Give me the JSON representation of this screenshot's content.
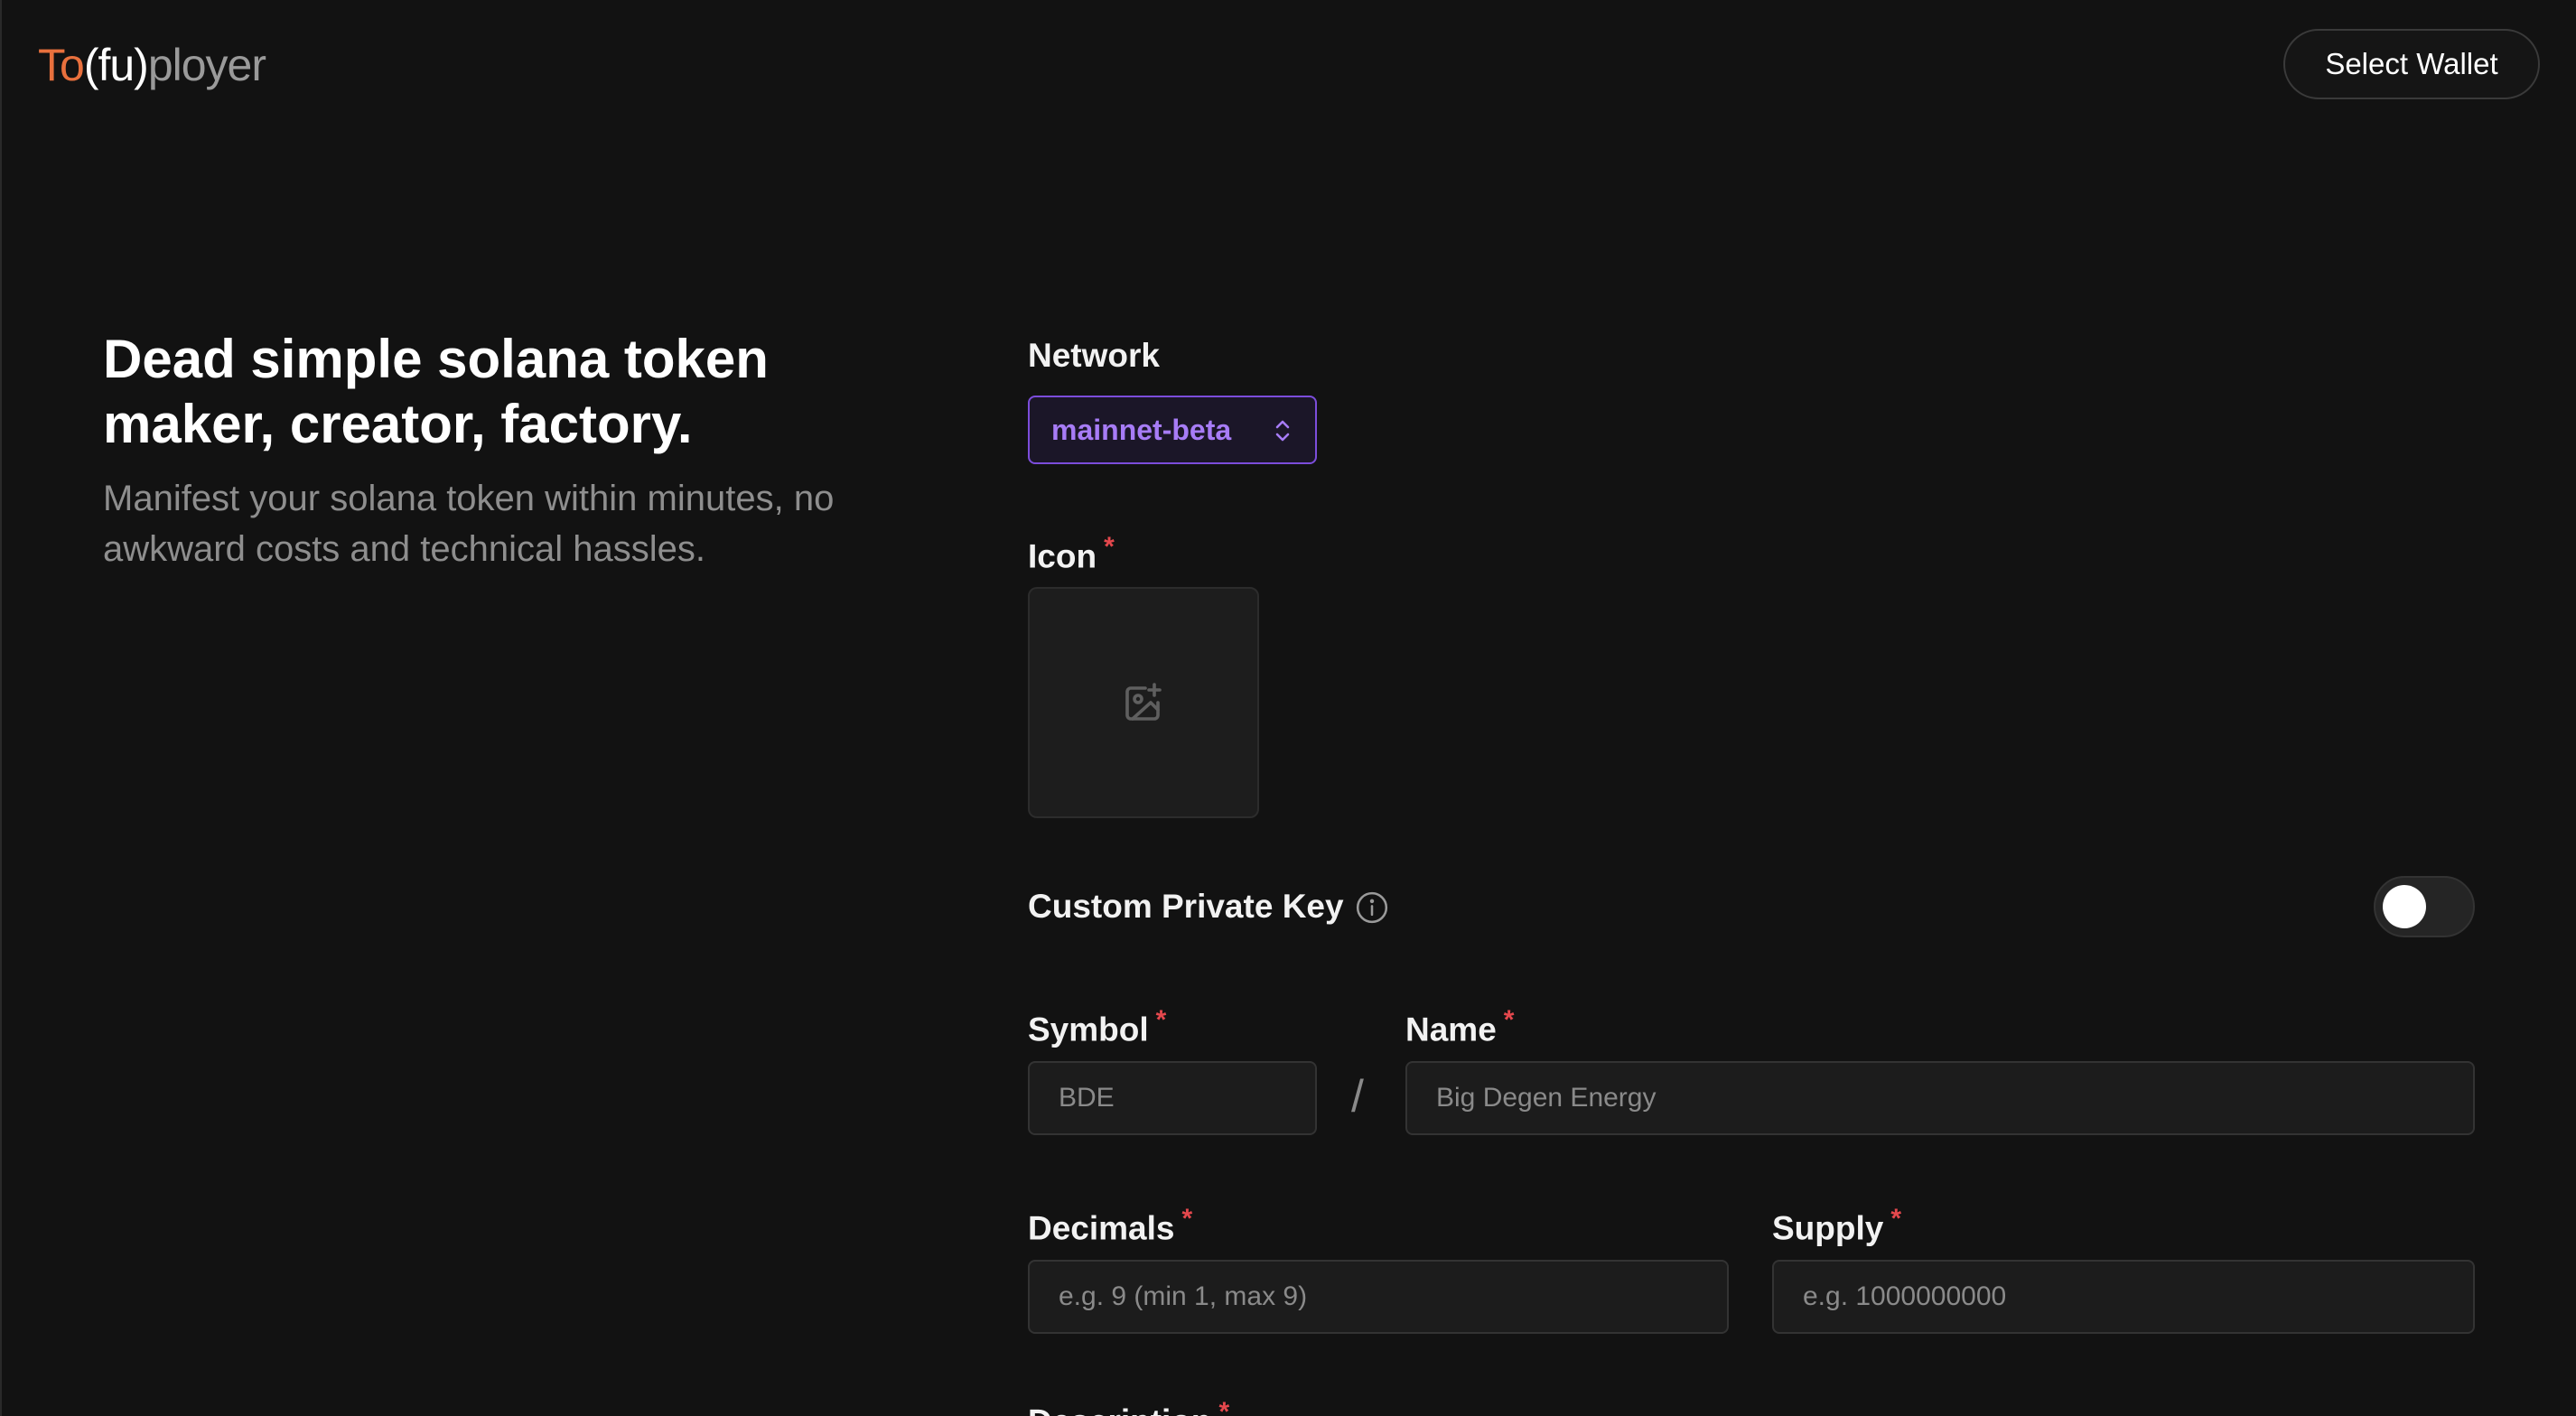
{
  "header": {
    "logo": {
      "part1": "To",
      "part2": "(fu)",
      "part3": "ployer"
    },
    "wallet_button_label": "Select Wallet"
  },
  "hero": {
    "title": "Dead simple solana token maker, creator, factory.",
    "subtitle": "Manifest your solana token within minutes, no awkward costs and technical hassles."
  },
  "form": {
    "network": {
      "label": "Network",
      "value": "mainnet-beta"
    },
    "icon": {
      "label": "Icon",
      "required_mark": "*",
      "icon_name": "image-plus-icon"
    },
    "custom_private_key": {
      "label": "Custom Private Key",
      "info_icon": "info-icon",
      "enabled": false
    },
    "symbol": {
      "label": "Symbol",
      "required_mark": "*",
      "placeholder": "BDE"
    },
    "separator": "/",
    "name": {
      "label": "Name",
      "required_mark": "*",
      "placeholder": "Big Degen Energy"
    },
    "decimals": {
      "label": "Decimals",
      "required_mark": "*",
      "placeholder": "e.g. 9 (min 1, max 9)"
    },
    "supply": {
      "label": "Supply",
      "required_mark": "*",
      "placeholder": "e.g. 1000000000"
    },
    "description": {
      "label": "Description",
      "required_mark": "*"
    }
  },
  "colors": {
    "background": "#121212",
    "logo_accent": "#e8703d",
    "network_accent": "#a77cf6",
    "required": "#e5484d"
  }
}
